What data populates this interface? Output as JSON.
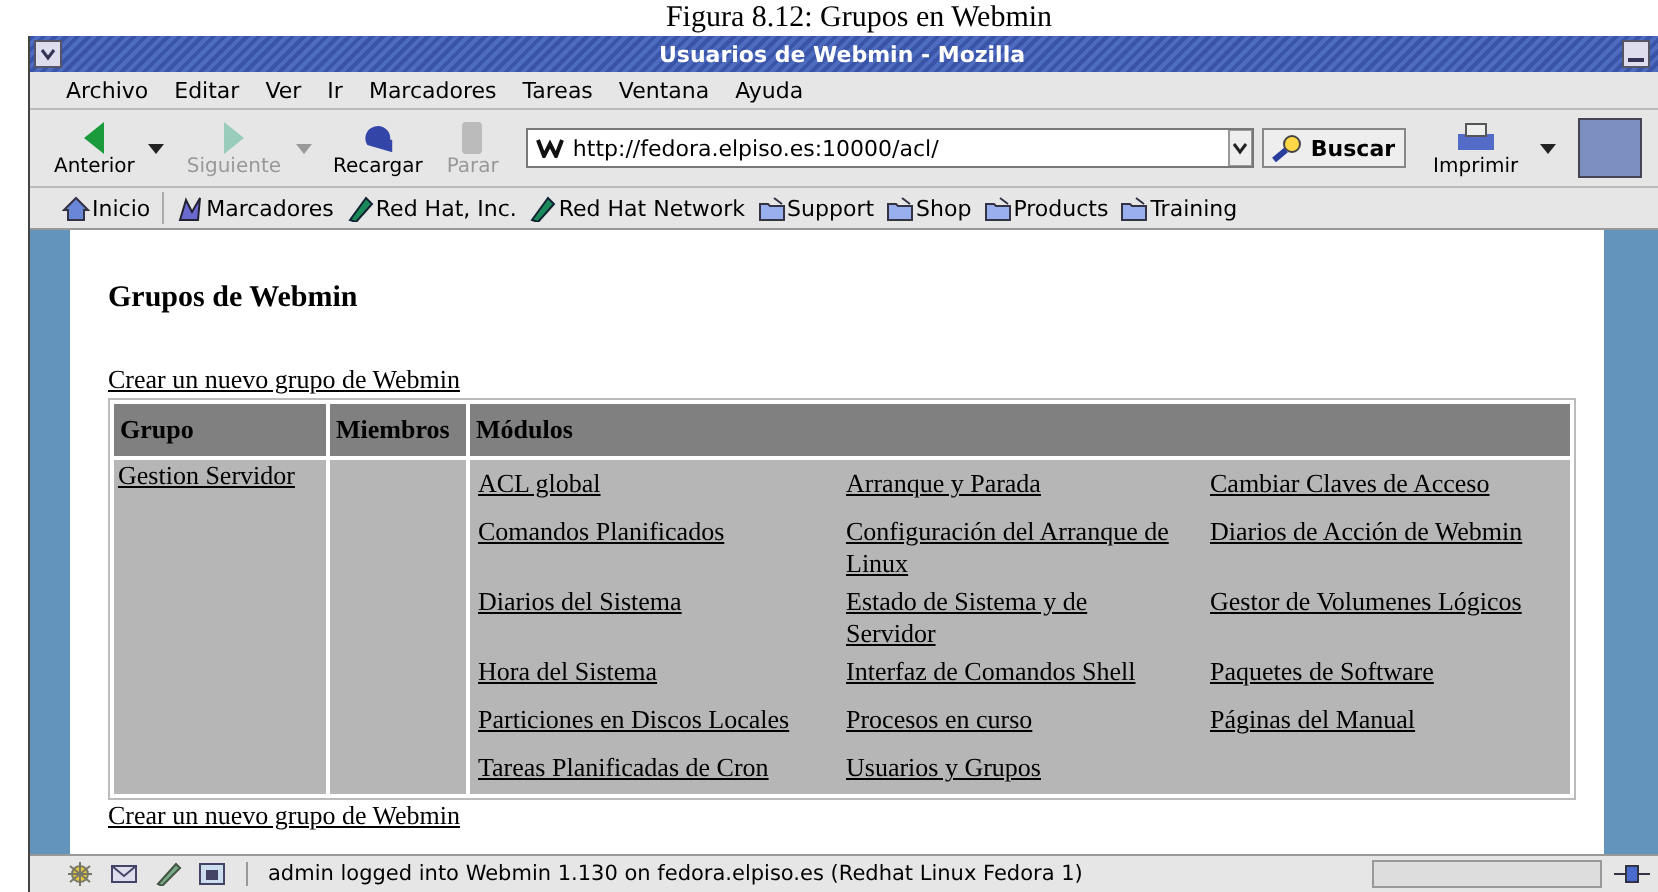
{
  "caption": "Figura 8.12: Grupos en Webmin",
  "window": {
    "title": "Usuarios de Webmin - Mozilla"
  },
  "menu": [
    "Archivo",
    "Editar",
    "Ver",
    "Ir",
    "Marcadores",
    "Tareas",
    "Ventana",
    "Ayuda"
  ],
  "toolbar": [
    {
      "label": "Anterior",
      "kind": "back",
      "disabled": false,
      "dropdown": true
    },
    {
      "label": "Siguiente",
      "kind": "forward",
      "disabled": true,
      "dropdown": true
    },
    {
      "label": "Recargar",
      "kind": "reload",
      "disabled": false,
      "dropdown": false
    },
    {
      "label": "Parar",
      "kind": "stop",
      "disabled": true,
      "dropdown": false
    }
  ],
  "address": {
    "value": "http://fedora.elpiso.es:10000/acl/"
  },
  "search_button": "Buscar",
  "print_button": "Imprimir",
  "bookmarks": [
    {
      "label": "Inicio",
      "kind": "home"
    },
    {
      "label": "Marcadores",
      "kind": "bookmarks"
    },
    {
      "label": "Red Hat, Inc.",
      "kind": "redhat"
    },
    {
      "label": "Red Hat Network",
      "kind": "redhat"
    },
    {
      "label": "Support",
      "kind": "folder"
    },
    {
      "label": "Shop",
      "kind": "folder"
    },
    {
      "label": "Products",
      "kind": "folder"
    },
    {
      "label": "Training",
      "kind": "folder"
    }
  ],
  "page": {
    "heading": "Grupos de Webmin",
    "create_link_top": "Crear un nuevo grupo de Webmin",
    "create_link_bottom": "Crear un nuevo grupo de Webmin",
    "table": {
      "columns": [
        "Grupo",
        "Miembros",
        "Módulos"
      ],
      "rows": [
        {
          "group": "Gestion  Servidor",
          "members": "",
          "modules": [
            "ACL global",
            "Arranque y Parada",
            "Cambiar Claves de Acceso",
            "Comandos Planificados",
            "Configuración del Arranque de Linux",
            "Diarios de Acción de Webmin",
            "Diarios del Sistema",
            "Estado de Sistema y de Servidor",
            "Gestor de Volumenes Lógicos",
            "Hora del Sistema",
            "Interfaz de Comandos Shell",
            "Paquetes de Software",
            "Particiones en Discos Locales",
            "Procesos en curso",
            "Páginas del Manual",
            "Tareas Planificadas de Cron",
            "Usuarios y Grupos"
          ]
        }
      ]
    }
  },
  "status_bar": {
    "text": "admin logged into Webmin 1.130 on fedora.elpiso.es (Redhat Linux Fedora 1)",
    "progress": {
      "level": 0
    }
  }
}
